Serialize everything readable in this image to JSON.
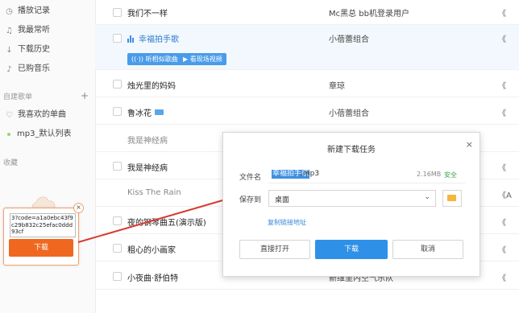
{
  "sidebar": {
    "items": [
      {
        "label": "播放记录",
        "icon": "clock-icon"
      },
      {
        "label": "我最常听",
        "icon": "headphone-icon"
      },
      {
        "label": "下载历史",
        "icon": "download-icon"
      },
      {
        "label": "已购音乐",
        "icon": "music-icon"
      }
    ],
    "section_created": "自建歌单",
    "playlists": [
      {
        "label": "我喜欢的单曲",
        "icon": "heart-icon"
      },
      {
        "label": "mp3_默认列表",
        "icon": "dot-icon"
      }
    ],
    "section_collect": "收藏"
  },
  "songs": [
    {
      "title": "我们不一样",
      "artist": "Mc黑总 bb机登录用户",
      "album": "《"
    },
    {
      "title": "幸福拍手歌",
      "artist": "小蓓蕾组合",
      "album": "《",
      "selected": true
    },
    {
      "title": "烛光里的妈妈",
      "artist": "章琼",
      "album": "《"
    },
    {
      "title": "鲁冰花",
      "artist": "小蓓蕾组合",
      "album": "《"
    },
    {
      "title": "我是神经病",
      "artist": "",
      "album": ""
    },
    {
      "title": "我是神经病",
      "artist": "",
      "album": "《"
    },
    {
      "title": "Kiss The Rain",
      "artist": "",
      "album": "《A"
    },
    {
      "title": "夜的钢琴曲五(演示版)",
      "artist": "",
      "album": "《"
    },
    {
      "title": "粗心的小画家",
      "artist": "",
      "album": "《"
    },
    {
      "title": "小夜曲·舒伯特",
      "artist": "新维里内空气乐队",
      "album": "《"
    }
  ],
  "selected_actions": {
    "listen_similar": "听相似歌曲",
    "watch_live": "看现场视频"
  },
  "download_widget": {
    "code_text": "3?code=a1a0ebc43f9c29b832c25efac0ddd93cf",
    "button": "下载",
    "close": "×"
  },
  "dialog": {
    "title": "新建下载任务",
    "close": "×",
    "filename_label": "文件名",
    "filename_selected": "幸福拍手歌",
    "filename_ext": ".mp3",
    "filesize": "2.16MB",
    "safe": "安全",
    "saveto_label": "保存到",
    "saveto_value": "桌面",
    "copy_link": "复制链接地址",
    "btn_open": "直接打开",
    "btn_download": "下载",
    "btn_cancel": "取消"
  },
  "colors": {
    "accent_blue": "#2f90e8",
    "download_orange": "#f0681f",
    "arrow_red": "#d63b2f",
    "safe_green": "#3aa34a"
  }
}
